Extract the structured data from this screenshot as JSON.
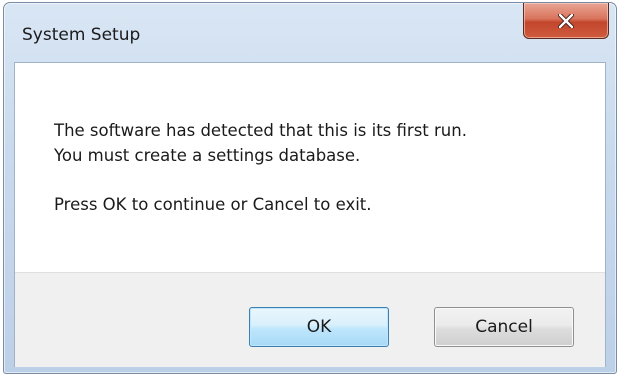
{
  "window": {
    "title": "System Setup",
    "close_icon": "close-x-icon"
  },
  "message": {
    "line1": "The software has detected that this is its first run.",
    "line2": "You must create a settings database.",
    "line3": "Press OK to continue or Cancel to exit."
  },
  "buttons": {
    "ok_label": "OK",
    "cancel_label": "Cancel"
  },
  "colors": {
    "close_button": "#c2462c",
    "ok_button_border": "#3c7fb1",
    "titlebar": "#c9daee"
  }
}
